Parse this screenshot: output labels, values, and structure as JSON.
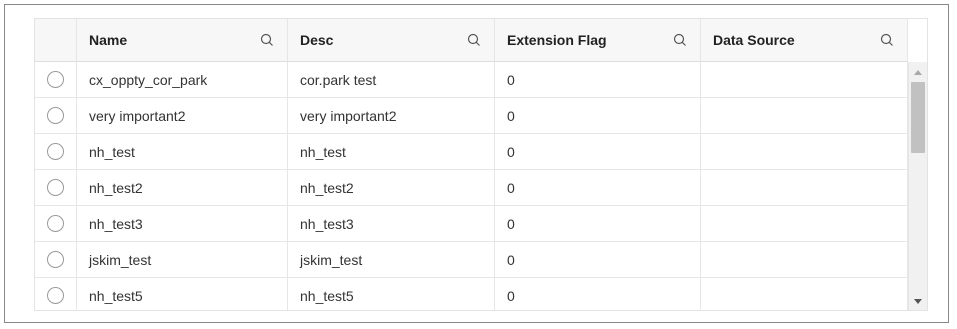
{
  "table": {
    "columns": [
      {
        "label": "Name"
      },
      {
        "label": "Desc"
      },
      {
        "label": "Extension Flag"
      },
      {
        "label": "Data Source"
      }
    ],
    "rows": [
      {
        "name": "cx_oppty_cor_park",
        "desc": "cor.park test",
        "extension_flag": "0",
        "data_source": ""
      },
      {
        "name": "very important2",
        "desc": "very important2",
        "extension_flag": "0",
        "data_source": ""
      },
      {
        "name": "nh_test",
        "desc": "nh_test",
        "extension_flag": "0",
        "data_source": ""
      },
      {
        "name": "nh_test2",
        "desc": "nh_test2",
        "extension_flag": "0",
        "data_source": ""
      },
      {
        "name": "nh_test3",
        "desc": "nh_test3",
        "extension_flag": "0",
        "data_source": ""
      },
      {
        "name": "jskim_test",
        "desc": "jskim_test",
        "extension_flag": "0",
        "data_source": ""
      },
      {
        "name": "nh_test5",
        "desc": "nh_test5",
        "extension_flag": "0",
        "data_source": ""
      }
    ]
  },
  "icons": {
    "column_search": "search-icon",
    "scroll_up": "scroll-up-arrow-icon",
    "scroll_down": "scroll-down-arrow-icon"
  }
}
